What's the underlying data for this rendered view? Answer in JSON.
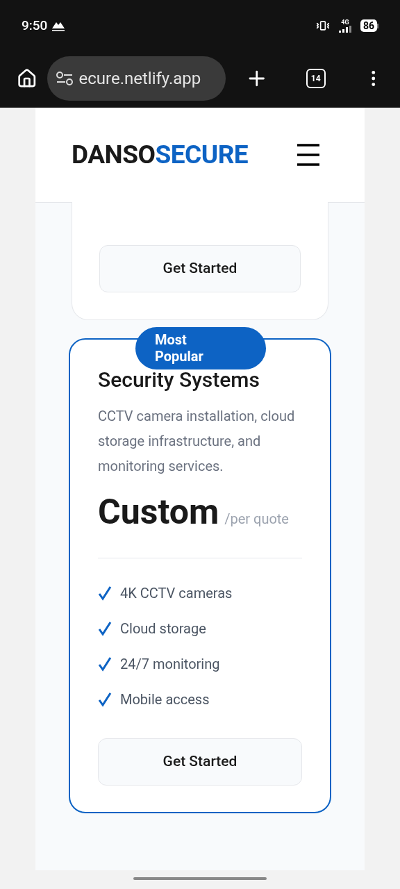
{
  "status_bar": {
    "time": "9:50",
    "battery": "86",
    "network": "4G"
  },
  "browser": {
    "url": "ecure.netlify.app",
    "tab_count": "14"
  },
  "header": {
    "logo_dark": "DANSO",
    "logo_accent": "SECURE"
  },
  "cards": [
    {
      "featured": false,
      "button": "Get Started"
    },
    {
      "featured": true,
      "badge": "Most Popular",
      "title": "Security Systems",
      "description": "CCTV camera installation, cloud storage infrastructure, and monitoring services.",
      "price": "Custom",
      "period": "/per quote",
      "features": [
        "4K CCTV cameras",
        "Cloud storage",
        "24/7 monitoring",
        "Mobile access"
      ],
      "button": "Get Started"
    }
  ]
}
